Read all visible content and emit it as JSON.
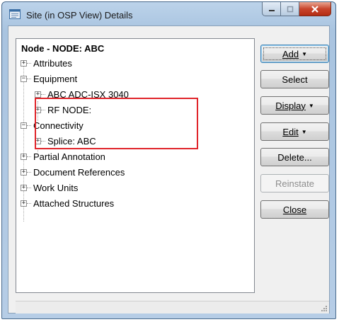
{
  "window": {
    "title": "Site (in OSP View) Details"
  },
  "tree": {
    "title": "Node - NODE: ABC",
    "items": [
      {
        "label": "Attributes",
        "expander": "+"
      },
      {
        "label": "Equipment",
        "expander": "−"
      },
      {
        "label": "ABC ADC-ISX 3040",
        "expander": "+"
      },
      {
        "label": "RF NODE:",
        "expander": "+"
      },
      {
        "label": "Connectivity",
        "expander": "−"
      },
      {
        "label": "Splice: ABC",
        "expander": "+"
      },
      {
        "label": "Partial Annotation",
        "expander": "+"
      },
      {
        "label": "Document References",
        "expander": "+"
      },
      {
        "label": "Work Units",
        "expander": "+"
      },
      {
        "label": "Attached Structures",
        "expander": "+"
      }
    ]
  },
  "buttons": {
    "add": "Add",
    "select": "Select",
    "display": "Display",
    "edit": "Edit",
    "delete": "Delete...",
    "reinstate": "Reinstate",
    "close": "Close"
  },
  "colors": {
    "highlight": "#e0242a",
    "title_bar": "#bcd3ea"
  },
  "icons": {
    "app": "window-details-icon",
    "minimize": "minimize-icon",
    "maximize": "maximize-icon",
    "close": "close-icon",
    "dropdown": "triangle-down-icon"
  }
}
